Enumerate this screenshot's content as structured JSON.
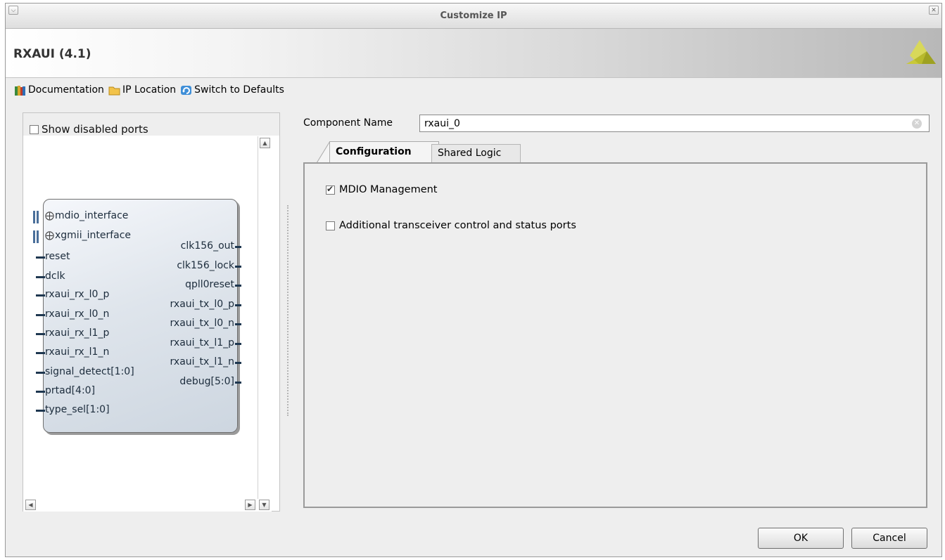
{
  "window": {
    "title": "Customize IP",
    "menu_icon": "chevron-down-icon",
    "close_icon": "close-icon"
  },
  "header": {
    "ip_title": "RXAUI (4.1)",
    "logo": "vivado-logo"
  },
  "toolbar": {
    "documentation": "Documentation",
    "ip_location": "IP Location",
    "switch_defaults": "Switch to Defaults"
  },
  "left_panel": {
    "show_disabled_ports": "Show disabled ports",
    "show_disabled_checked": false
  },
  "block": {
    "interfaces": [
      "mdio_interface",
      "xgmii_interface"
    ],
    "inputs": [
      "reset",
      "dclk",
      "rxaui_rx_l0_p",
      "rxaui_rx_l0_n",
      "rxaui_rx_l1_p",
      "rxaui_rx_l1_n",
      "signal_detect[1:0]",
      "prtad[4:0]",
      "type_sel[1:0]"
    ],
    "outputs": [
      "clk156_out",
      "clk156_lock",
      "qpll0reset",
      "rxaui_tx_l0_p",
      "rxaui_tx_l0_n",
      "rxaui_tx_l1_p",
      "rxaui_tx_l1_n",
      "debug[5:0]"
    ]
  },
  "component": {
    "label": "Component Name",
    "value": "rxaui_0"
  },
  "tabs": [
    {
      "label": "Configuration",
      "active": true
    },
    {
      "label": "Shared Logic",
      "active": false
    }
  ],
  "config": {
    "mdio_management": {
      "label": "MDIO Management",
      "checked": true
    },
    "additional_ports": {
      "label": "Additional transceiver control and status ports",
      "checked": false
    }
  },
  "buttons": {
    "ok": "OK",
    "cancel": "Cancel"
  },
  "colors": {
    "block_fill": "#dfe5ec",
    "pin": "#1e3750",
    "bus": "#4a6f9a",
    "logo": "#c9c93a"
  }
}
